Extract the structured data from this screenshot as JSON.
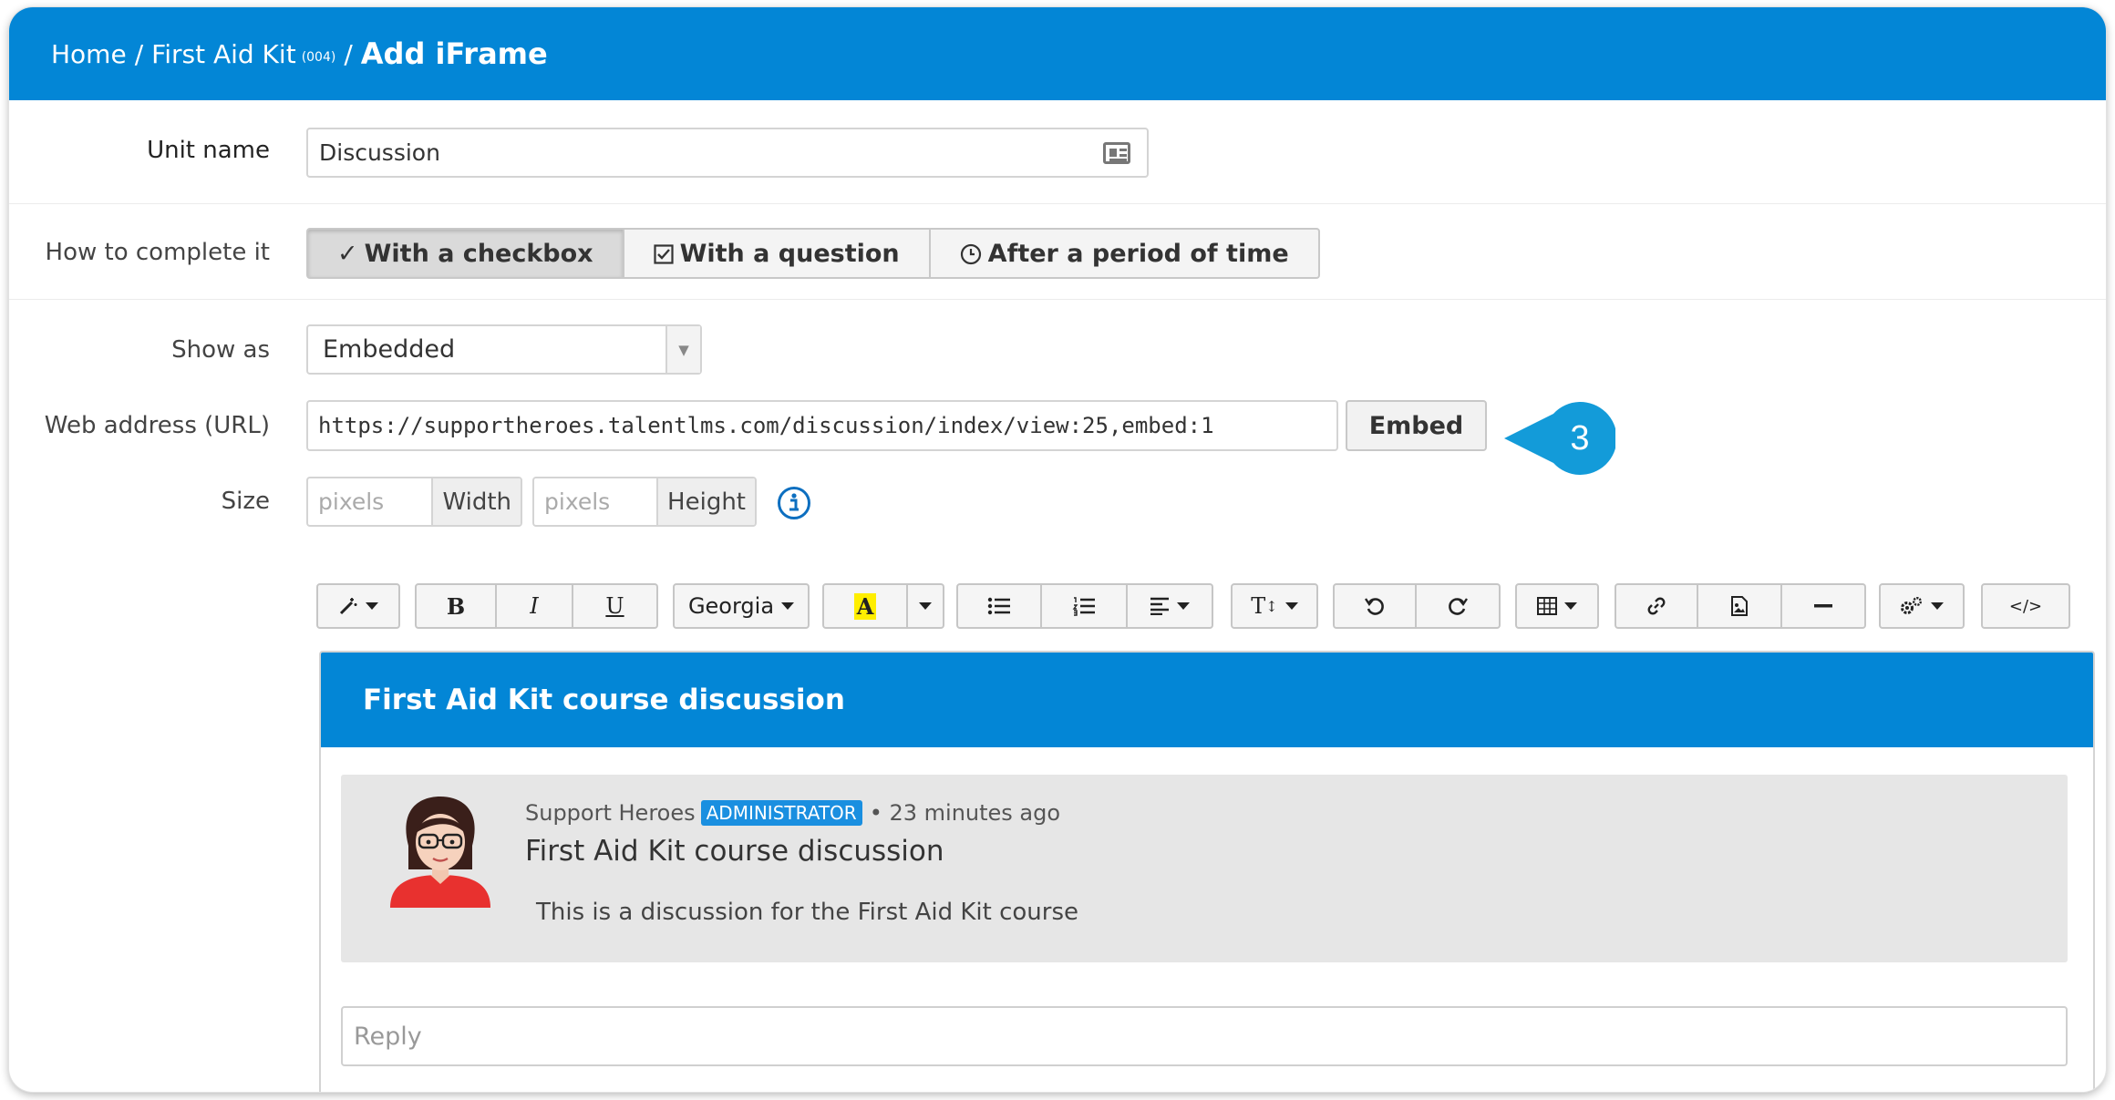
{
  "breadcrumb": {
    "home": "Home",
    "separator": "/",
    "course": "First Aid Kit",
    "course_code": "(004)",
    "current": "Add iFrame"
  },
  "form": {
    "unit_name": {
      "label": "Unit name",
      "value": "Discussion",
      "icon": "id-card-icon"
    },
    "completion": {
      "label": "How to complete it",
      "options": [
        {
          "label": "With a checkbox",
          "icon": "checkmark-icon",
          "selected": true
        },
        {
          "label": "With a question",
          "icon": "checkbox-icon",
          "selected": false
        },
        {
          "label": "After a period of time",
          "icon": "clock-icon",
          "selected": false
        }
      ]
    },
    "show_as": {
      "label": "Show as",
      "value": "Embedded"
    },
    "url": {
      "label": "Web address (URL)",
      "value": "https://supportheroes.talentlms.com/discussion/index/view:25,embed:1",
      "embed_button": "Embed"
    },
    "size": {
      "label": "Size",
      "width_placeholder": "pixels",
      "width_addon": "Width",
      "height_placeholder": "pixels",
      "height_addon": "Height",
      "info_icon": "info-icon"
    }
  },
  "callout": {
    "number": "3",
    "color": "#139bd9"
  },
  "toolbar": {
    "font_name": "Georgia",
    "bold": "B",
    "italic": "I",
    "underline": "U",
    "highlight": "A",
    "font_size_glyph": "T",
    "code_glyph": "</>"
  },
  "editor": {
    "header_title": "First Aid Kit course discussion",
    "post": {
      "author": "Support Heroes",
      "role_badge": "ADMINISTRATOR",
      "time": "• 23 minutes ago",
      "title": "First Aid Kit course discussion",
      "body": "This is a discussion for the First Aid Kit course"
    },
    "reply_placeholder": "Reply"
  },
  "colors": {
    "brand_blue": "#0386d6",
    "badge_blue": "#1a8fe0",
    "highlight_yellow": "#ffee00"
  }
}
